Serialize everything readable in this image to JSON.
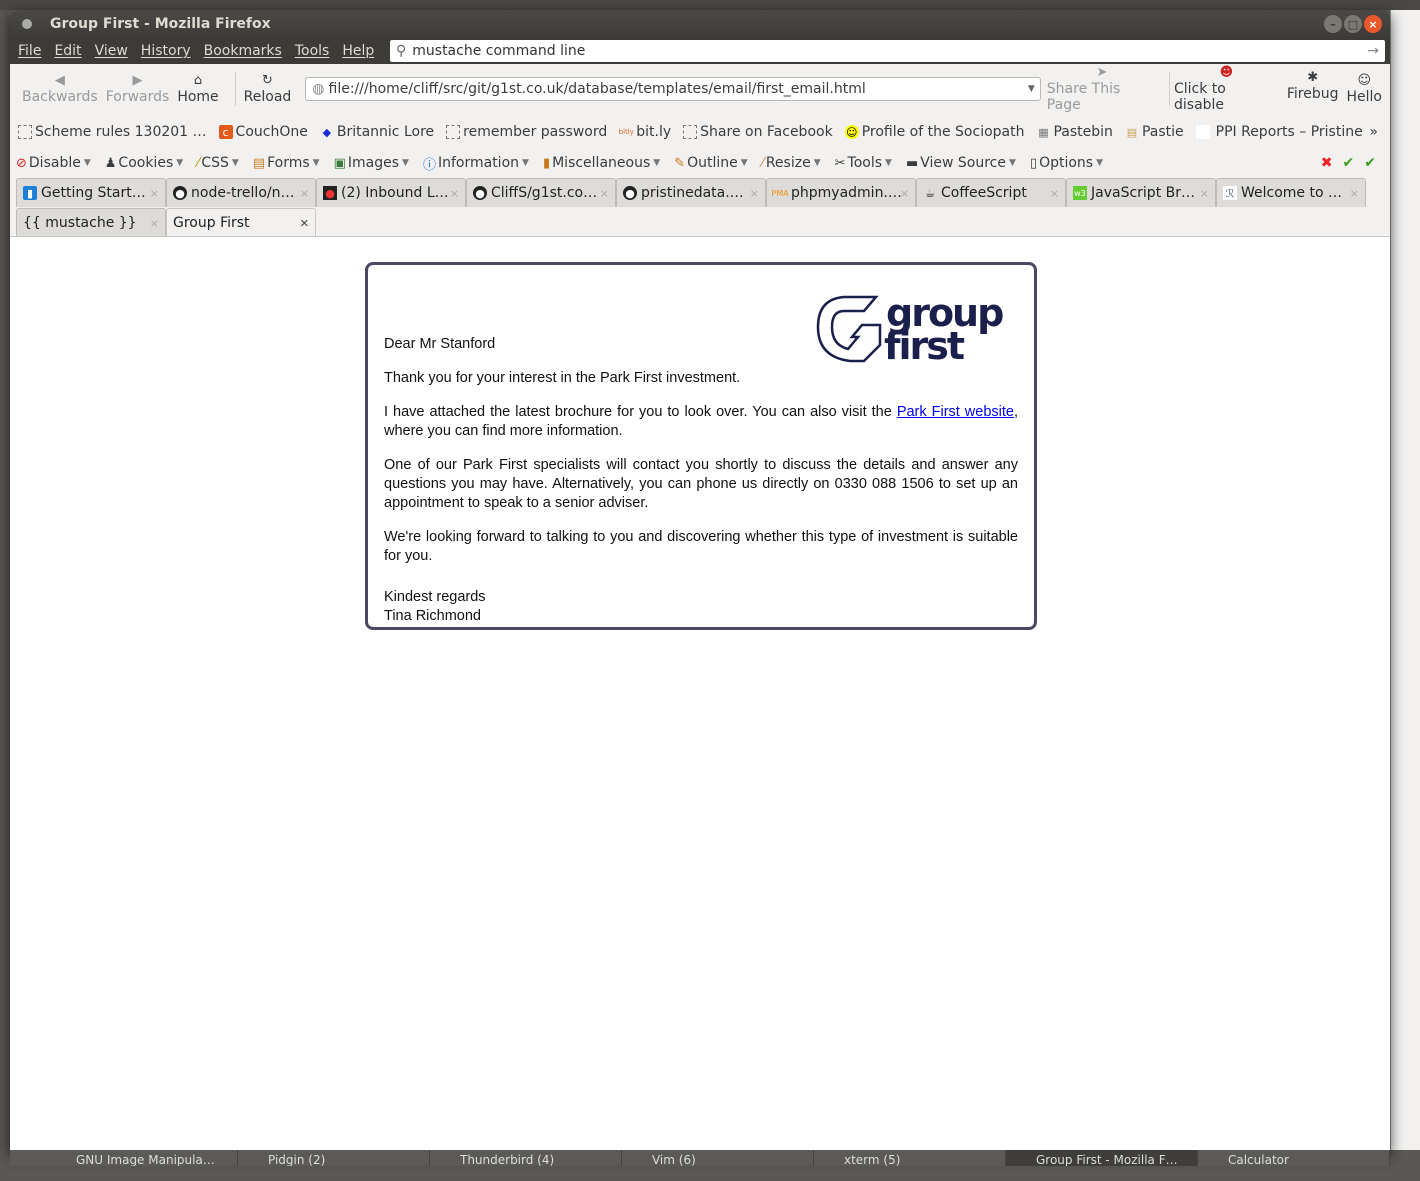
{
  "window": {
    "title": "Group First - Mozilla Firefox"
  },
  "menu": [
    "File",
    "Edit",
    "View",
    "History",
    "Bookmarks",
    "Tools",
    "Help"
  ],
  "search": {
    "value": "mustache command line"
  },
  "nav": {
    "back": "Backwards",
    "forward": "Forwards",
    "home": "Home",
    "reload": "Reload",
    "url": "file:///home/cliff/src/git/g1st.co.uk/database/templates/email/first_email.html",
    "share": "Share This Page",
    "click_disable": "Click to disable",
    "firebug": "Firebug",
    "hello": "Hello"
  },
  "bookmarks": [
    "Scheme rules 130201 …",
    "CouchOne",
    "Britannic Lore",
    "remember password",
    "bit.ly",
    "Share on Facebook",
    "Profile of the Sociopath",
    "Pastebin",
    "Pastie",
    "PPI Reports – Pristine"
  ],
  "devtools": [
    "Disable",
    "Cookies",
    "CSS",
    "Forms",
    "Images",
    "Information",
    "Miscellaneous",
    "Outline",
    "Resize",
    "Tools",
    "View Source",
    "Options"
  ],
  "tabs_row1": [
    "Getting Start…",
    "node-trello/n…",
    "(2) Inbound L…",
    "CliffS/g1st.co…",
    "pristinedata.…",
    "phpmyadmin.…",
    "CoffeeScript",
    "JavaScript Br…",
    "Welcome to …"
  ],
  "tabs_row2": [
    "{{ mustache }}",
    "Group First"
  ],
  "email": {
    "logo_text": "group first",
    "greeting": "Dear Mr Stanford",
    "p1": "Thank you for your interest in the Park First investment.",
    "p2_before": "I have attached the latest brochure for you to look over. You can also visit the ",
    "p2_link": "Park First website",
    "p2_after": ", where you can find more information.",
    "p3": "One of our Park First specialists will contact you shortly to discuss the details and answer any questions you may have. Alternatively, you can phone us directly on 0330 088 1506 to set up an appointment to speak to a senior adviser.",
    "p4": "We're looking forward to talking to you and discovering whether this type of investment is suitable for you.",
    "signoff": "Kindest regards",
    "name": "Tina Richmond"
  },
  "taskbar": [
    "GNU Image Manipula…",
    "Pidgin (2)",
    "Thunderbird (4)",
    "Vim (6)",
    "xterm (5)",
    "Group First - Mozilla F…",
    "Calculator"
  ],
  "colors": {
    "brand": "#1a1f4b",
    "border": "#4d4763",
    "link": "#0000ee"
  }
}
